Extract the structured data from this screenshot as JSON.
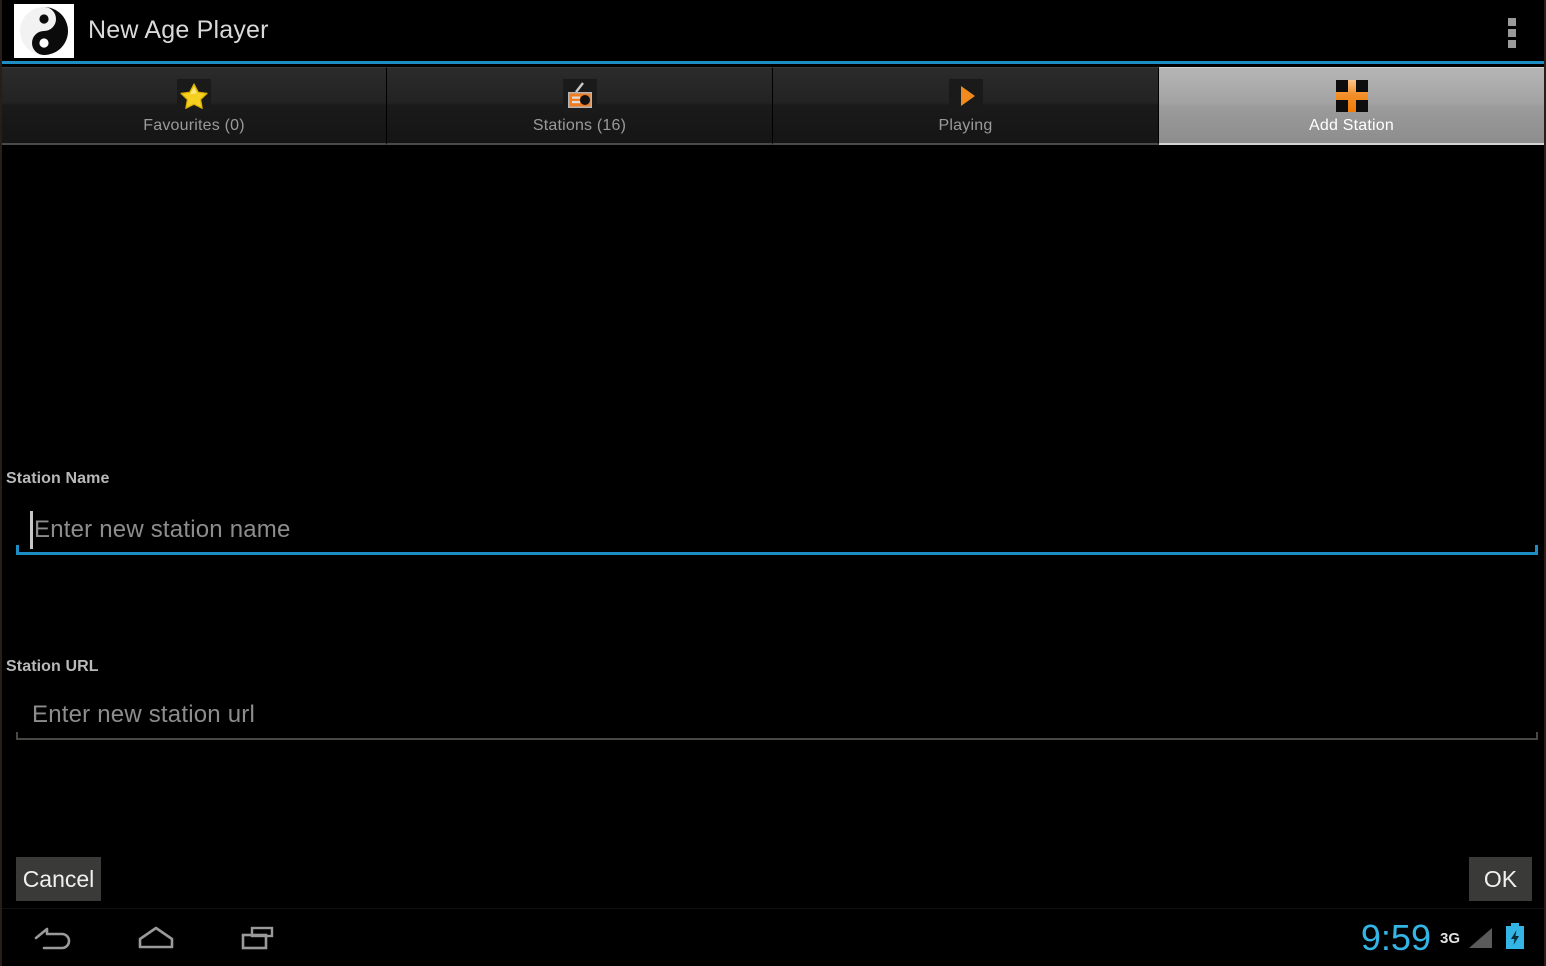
{
  "app": {
    "title": "New Age Player",
    "logo_icon": "yin-yang-icon",
    "overflow_icon": "overflow-menu-icon",
    "accent_blue": "#1e8dc4",
    "accent_orange": "#f08a1e",
    "star_yellow": "#f5d020"
  },
  "tabs": [
    {
      "label": "Favourites (0)",
      "icon": "star-icon",
      "selected": false
    },
    {
      "label": "Stations (16)",
      "icon": "radio-icon",
      "selected": false
    },
    {
      "label": "Playing",
      "icon": "play-icon",
      "selected": false
    },
    {
      "label": "Add Station",
      "icon": "plus-icon",
      "selected": true
    }
  ],
  "form": {
    "station_name": {
      "label": "Station Name",
      "placeholder": "Enter new station name",
      "value": "",
      "focused": true
    },
    "station_url": {
      "label": "Station URL",
      "placeholder": "Enter new station url",
      "value": "",
      "focused": false
    }
  },
  "actions": {
    "cancel_label": "Cancel",
    "ok_label": "OK"
  },
  "system_bar": {
    "back_icon": "back-arrow-icon",
    "home_icon": "home-icon",
    "recents_icon": "recent-apps-icon",
    "clock": "9:59",
    "network": "3G",
    "signal_icon": "signal-bars-icon",
    "battery_icon": "battery-charging-icon"
  }
}
